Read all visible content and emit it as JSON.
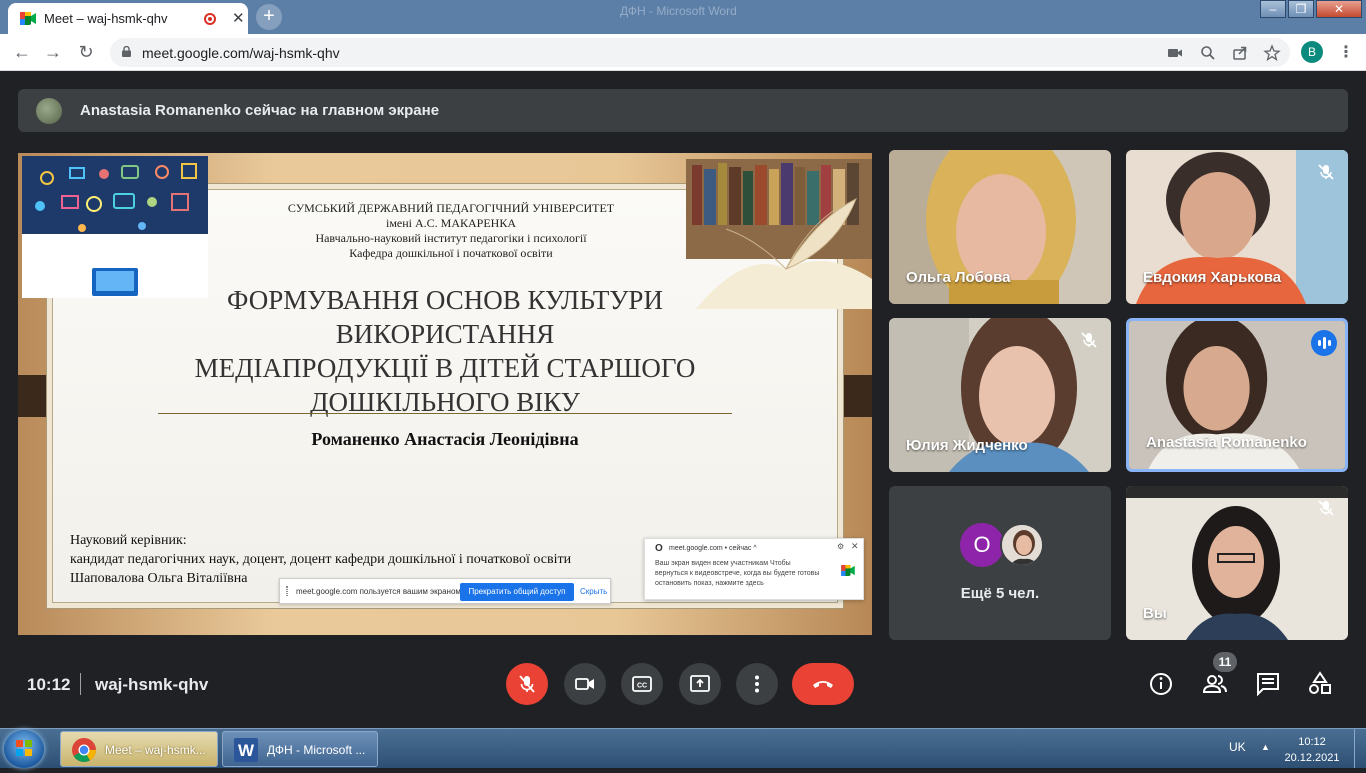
{
  "browser": {
    "tab_title": "Meet – waj-hsmk-qhv",
    "tab_close": "✕",
    "new_tab": "+",
    "window_title_behind": "ДФН - Microsoft Word",
    "url": "meet.google.com/waj-hsmk-qhv",
    "profile_initial": "B"
  },
  "banner": {
    "text": "Anastasia Romanenko сейчас на главном экране"
  },
  "slide": {
    "university_lines": [
      "СУМСЬКИЙ ДЕРЖАВНИЙ ПЕДАГОГІЧНИЙ УНІВЕРСИТЕТ",
      "імені А.С. МАКАРЕНКА",
      "Навчально-науковий інститут педагогіки і психології",
      "Кафедра дошкільної і початкової освіти"
    ],
    "title_lines": [
      "ФОРМУВАННЯ ОСНОВ КУЛЬТУРИ",
      "ВИКОРИСТАННЯ",
      "МЕДІАПРОДУКЦІЇ В ДІТЕЙ СТАРШОГО",
      "ДОШКІЛЬНОГО ВІКУ"
    ],
    "author": "Романенко Анастасія Леонідівна",
    "supervisor_lines": [
      "Науковий керівник:",
      "кандидат педагогічних наук, доцент, доцент кафедри дошкільної і початкової освіти",
      "Шаповалова Ольга Віталіївна"
    ]
  },
  "share_bar": {
    "message": "meet.google.com пользуется вашим экраном.",
    "stop_label": "Прекратить общий доступ",
    "hide_label": "Скрыть"
  },
  "toast": {
    "logo": "O",
    "source": "meet.google.com  • сейчас ^",
    "gear": "⚙",
    "close": "✕",
    "body": "Ваш экран виден всем участникам Чтобы вернуться к видеовстрече, когда вы будете готовы остановить показ, нажмите здесь"
  },
  "participants": [
    {
      "name": "Ольга Лобова",
      "muted": false,
      "speaking": false
    },
    {
      "name": "Евдокия Харькова",
      "muted": true,
      "speaking": false
    },
    {
      "name": "Юлия Жидченко",
      "muted": true,
      "speaking": false
    },
    {
      "name": "Anastasia Romanenko",
      "muted": false,
      "speaking": true
    },
    {
      "name": "Вы",
      "muted": true,
      "speaking": false
    }
  ],
  "more_tile": {
    "avatar_letter": "О",
    "label": "Ещё 5 чел."
  },
  "meeting": {
    "time": "10:12",
    "code": "waj-hsmk-qhv",
    "participant_count": "11"
  },
  "taskbar": {
    "chrome_label": "Meet – waj-hsmk...",
    "word_label": "ДФН - Microsoft ...",
    "language": "UK",
    "time": "10:12",
    "date": "20.12.2021"
  },
  "colors": {
    "meet_bg": "#202124",
    "hangup_red": "#ea4335",
    "speaking_blue": "#1a73e8",
    "active_border": "#8ab4f8"
  }
}
